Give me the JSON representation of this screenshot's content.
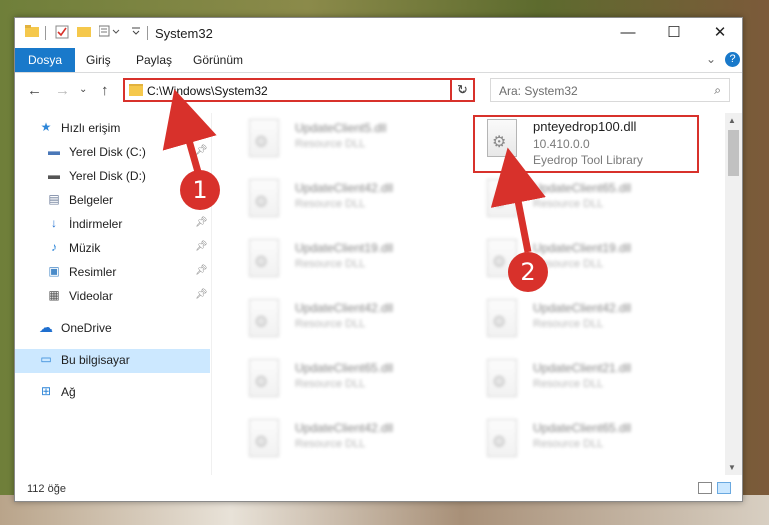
{
  "window": {
    "title": "System32",
    "controls": {
      "minimize": "—",
      "maximize": "☐",
      "close": "✕"
    }
  },
  "ribbon": {
    "tabs": [
      {
        "label": "Dosya",
        "active": true
      },
      {
        "label": "Giriş",
        "active": false
      },
      {
        "label": "Paylaş",
        "active": false
      },
      {
        "label": "Görünüm",
        "active": false
      }
    ],
    "help": "?"
  },
  "address": {
    "path": "C:\\Windows\\System32",
    "search_placeholder": "Ara: System32"
  },
  "sidebar": {
    "items": [
      {
        "label": "Hızlı erişim",
        "icon": "star-icon",
        "glyph": "★",
        "color": "#2e86d8",
        "pinned": false
      },
      {
        "label": "Yerel Disk (C:)",
        "icon": "drive-icon",
        "glyph": "▬",
        "color": "#4a78b8",
        "pinned": true
      },
      {
        "label": "Yerel Disk (D:)",
        "icon": "drive-icon",
        "glyph": "▬",
        "color": "#555555",
        "pinned": false
      },
      {
        "label": "Belgeler",
        "icon": "document-icon",
        "glyph": "▤",
        "color": "#6b7b99",
        "pinned": false
      },
      {
        "label": "İndirmeler",
        "icon": "download-icon",
        "glyph": "↓",
        "color": "#1f6fcf",
        "pinned": true
      },
      {
        "label": "Müzik",
        "icon": "music-icon",
        "glyph": "♪",
        "color": "#2e86d8",
        "pinned": true
      },
      {
        "label": "Resimler",
        "icon": "pictures-icon",
        "glyph": "▣",
        "color": "#4a8bc9",
        "pinned": true
      },
      {
        "label": "Videolar",
        "icon": "video-icon",
        "glyph": "▦",
        "color": "#555555",
        "pinned": true
      },
      {
        "label": "OneDrive",
        "icon": "cloud-icon",
        "glyph": "☁",
        "color": "#1f6fcf",
        "pinned": false
      },
      {
        "label": "Bu bilgisayar",
        "icon": "computer-icon",
        "glyph": "▭",
        "color": "#2e86d8",
        "pinned": false,
        "selected": true
      },
      {
        "label": "Ağ",
        "icon": "network-icon",
        "glyph": "⊞",
        "color": "#2e86d8",
        "pinned": false
      }
    ]
  },
  "files": {
    "left": [
      {
        "name": "UpdateClient5.dll",
        "type": "Resource DLL"
      },
      {
        "name": "UpdateClient42.dll",
        "type": "Resource DLL"
      },
      {
        "name": "UpdateClient19.dll",
        "type": "Resource DLL"
      },
      {
        "name": "UpdateClient42.dll",
        "type": "Resource DLL"
      },
      {
        "name": "UpdateClient65.dll",
        "type": "Resource DLL"
      },
      {
        "name": "UpdateClient42.dll",
        "type": "Resource DLL"
      }
    ],
    "right": [
      {
        "name": "pnteyedrop100.dll",
        "version": "10.410.0.0",
        "type": "Eyedrop Tool Library",
        "highlight": true
      },
      {
        "name": "UpdateClient65.dll",
        "type": "Resource DLL"
      },
      {
        "name": "UpdateClient19.dll",
        "type": "Resource DLL"
      },
      {
        "name": "UpdateClient42.dll",
        "type": "Resource DLL"
      },
      {
        "name": "UpdateClient21.dll",
        "type": "Resource DLL"
      },
      {
        "name": "UpdateClient65.dll",
        "type": "Resource DLL"
      }
    ]
  },
  "status": {
    "count": "112 öğe"
  },
  "annotations": {
    "step1": "1",
    "step2": "2",
    "color": "#d8312b"
  }
}
